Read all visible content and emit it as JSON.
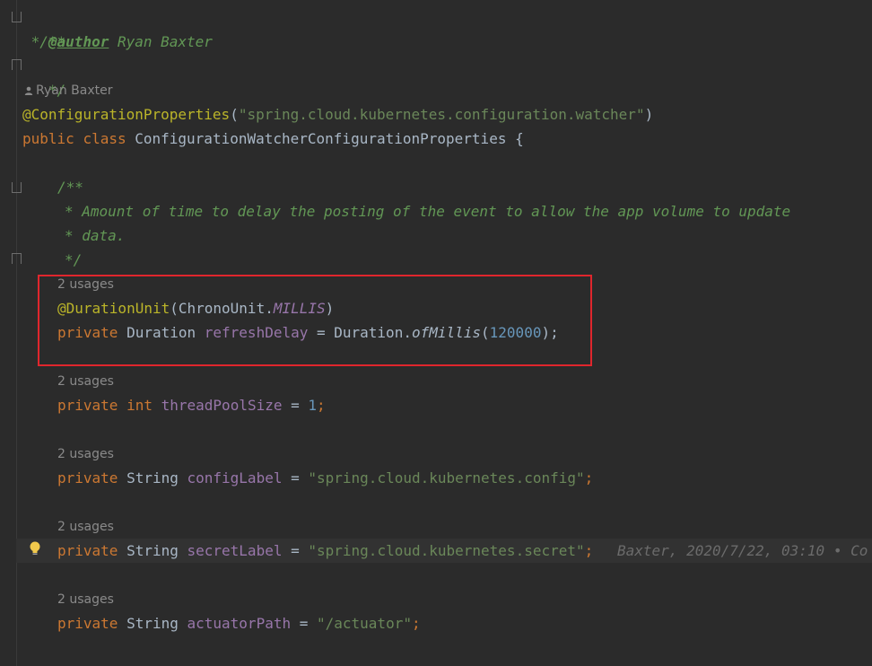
{
  "javadoc_class": {
    "open": "/**",
    "author_prefix": " * ",
    "author_tag": "@author",
    "author_name": " Ryan Baxter",
    "close": " */"
  },
  "author_hint": "Ryan Baxter",
  "class_annotation": {
    "name": "@ConfigurationProperties",
    "paren_open": "(",
    "value": "\"spring.cloud.kubernetes.configuration.watcher\"",
    "paren_close": ")"
  },
  "class_decl": {
    "kw_public": "public",
    "kw_class": "class",
    "name": " ConfigurationWatcherConfigurationProperties ",
    "brace": "{"
  },
  "javadoc_field": {
    "open": "/**",
    "line1": "* Amount of time to delay the posting of the event to allow the app volume to update",
    "line2": "* data.",
    "close": "*/"
  },
  "usages_label": "2 usages",
  "field_refresh": {
    "annotation": "@DurationUnit",
    "ann_open": "(ChronoUnit.",
    "ann_const": "MILLIS",
    "ann_close": ")",
    "kw": "private",
    "type": " Duration ",
    "name": "refreshDelay",
    "eq": " = Duration.",
    "method": "ofMillis",
    "paren_open": "(",
    "value": "120000",
    "paren_close": ");"
  },
  "field_threadpool": {
    "kw": "private",
    "type": "int",
    "name": "threadPoolSize",
    "eq": " = ",
    "value": "1",
    "semi": ";"
  },
  "field_configlabel": {
    "kw": "private",
    "type": " String ",
    "name": "configLabel",
    "eq": " = ",
    "value": "\"spring.cloud.kubernetes.config\"",
    "semi": ";"
  },
  "field_secretlabel": {
    "kw": "private",
    "type": " String ",
    "name": "secretLabel",
    "eq": " = ",
    "value": "\"spring.cloud.kubernetes.secret\"",
    "semi": ";",
    "blame": "Baxter, 2020/7/22, 03:10 • Co"
  },
  "field_actuator": {
    "kw": "private",
    "type": " String ",
    "name": "actuatorPath",
    "eq": " = ",
    "value": "\"/actuator\"",
    "semi": ";"
  },
  "colors": {
    "background": "#2b2b2b",
    "keyword": "#cc7832",
    "string": "#6a8759",
    "field": "#9876aa",
    "annotation": "#bbb529",
    "number": "#6897bb",
    "doc": "#629755",
    "highlight_box": "#e0262d"
  }
}
